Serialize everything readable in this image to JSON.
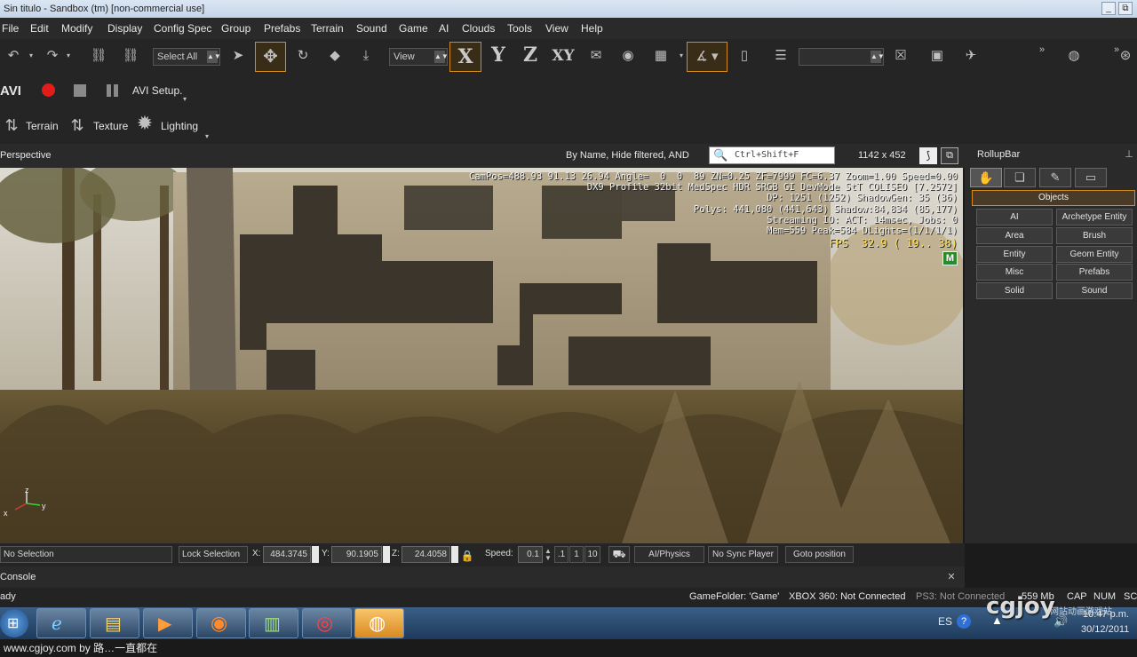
{
  "window": {
    "title": "Sin titulo - Sandbox (tm) [non-commercial use]",
    "min": "_",
    "max": "⧉"
  },
  "menu": [
    "File",
    "Edit",
    "Modify",
    "Display",
    "Config Spec",
    "Group",
    "Prefabs",
    "Terrain",
    "Sound",
    "Game",
    "AI",
    "Clouds",
    "Tools",
    "View",
    "Help"
  ],
  "toolbar": {
    "select_combo": "Select All",
    "view_combo": "View",
    "axis_x": "X",
    "axis_y": "Y",
    "axis_z": "Z",
    "axis_xy": "XY",
    "overflow": "»"
  },
  "avi": {
    "label": "AVI",
    "setup": "AVI Setup."
  },
  "modes": {
    "terrain": "Terrain",
    "texture": "Texture",
    "lighting": "Lighting"
  },
  "viewport": {
    "name": "Perspective",
    "filter_text": "By Name, Hide filtered, AND",
    "search_placeholder": "Ctrl+Shift+F",
    "resolution": "1142 x 452",
    "stats": [
      "CamPos=488.93 91.13 26.94 Angle=  0  0  89 ZN=0.25 ZF=7999 FC=6.37 Zoom=1.00 Speed=0.00",
      "DX9 Profile 32bit MedSpec HDR SRGB GI DevMode StT COLISEO [7.2572]",
      "DP: 1251 (1252) ShadowGen: 35 (36)",
      "Polys: 441,080 (441,643) Shadow:84,834 (85,177)",
      "Streaming IO: ACT: 14msec, Jobs: 0",
      "Mem=559 Peak=584 DLights=(1/1/1/1)"
    ],
    "fps": "FPS  32.9 ( 19.. 38)",
    "m_badge": "M",
    "gizmo": {
      "z": "z",
      "x": "x",
      "y": "y"
    }
  },
  "rollup": {
    "title": "RollupBar",
    "section": "Objects",
    "buttons": [
      "AI",
      "Archetype Entity",
      "Area",
      "Brush",
      "Entity",
      "Geom Entity",
      "Misc",
      "Prefabs",
      "Solid",
      "Sound"
    ]
  },
  "status": {
    "selection": "No Selection",
    "lock": "Lock Selection",
    "x_label": "X:",
    "x": "484.3745",
    "y_label": "Y:",
    "y": "90.1905",
    "z_label": "Z:",
    "z": "24.4058",
    "speed_label": "Speed:",
    "speed": "0.1",
    "speed_presets": [
      ".1",
      "1",
      "10"
    ],
    "ai_physics": "AI/Physics",
    "sync": "No Sync Player",
    "goto": "Goto position"
  },
  "console": {
    "label": "Console",
    "close": "✕",
    "ready": "ady"
  },
  "info": {
    "gamefolder": "GameFolder: 'Game'",
    "xbox": "XBOX 360: Not Connected",
    "ps3": "PS3: Not Connected",
    "mem": "559 Mb",
    "cap": "CAP",
    "num": "NUM",
    "scr": "SC"
  },
  "tray": {
    "lang": "ES",
    "time": "10:47 p.m.",
    "date": "30/12/2011"
  },
  "footer": {
    "credit": "www.cgjoy.com by 路…一直都在"
  },
  "watermark": {
    "text": "cgjoy",
    "sub": "网站动画游戏站"
  },
  "colors": {
    "accent": "#d68a1a",
    "fps": "#ffe14d",
    "badge": "#2c8a2c"
  }
}
